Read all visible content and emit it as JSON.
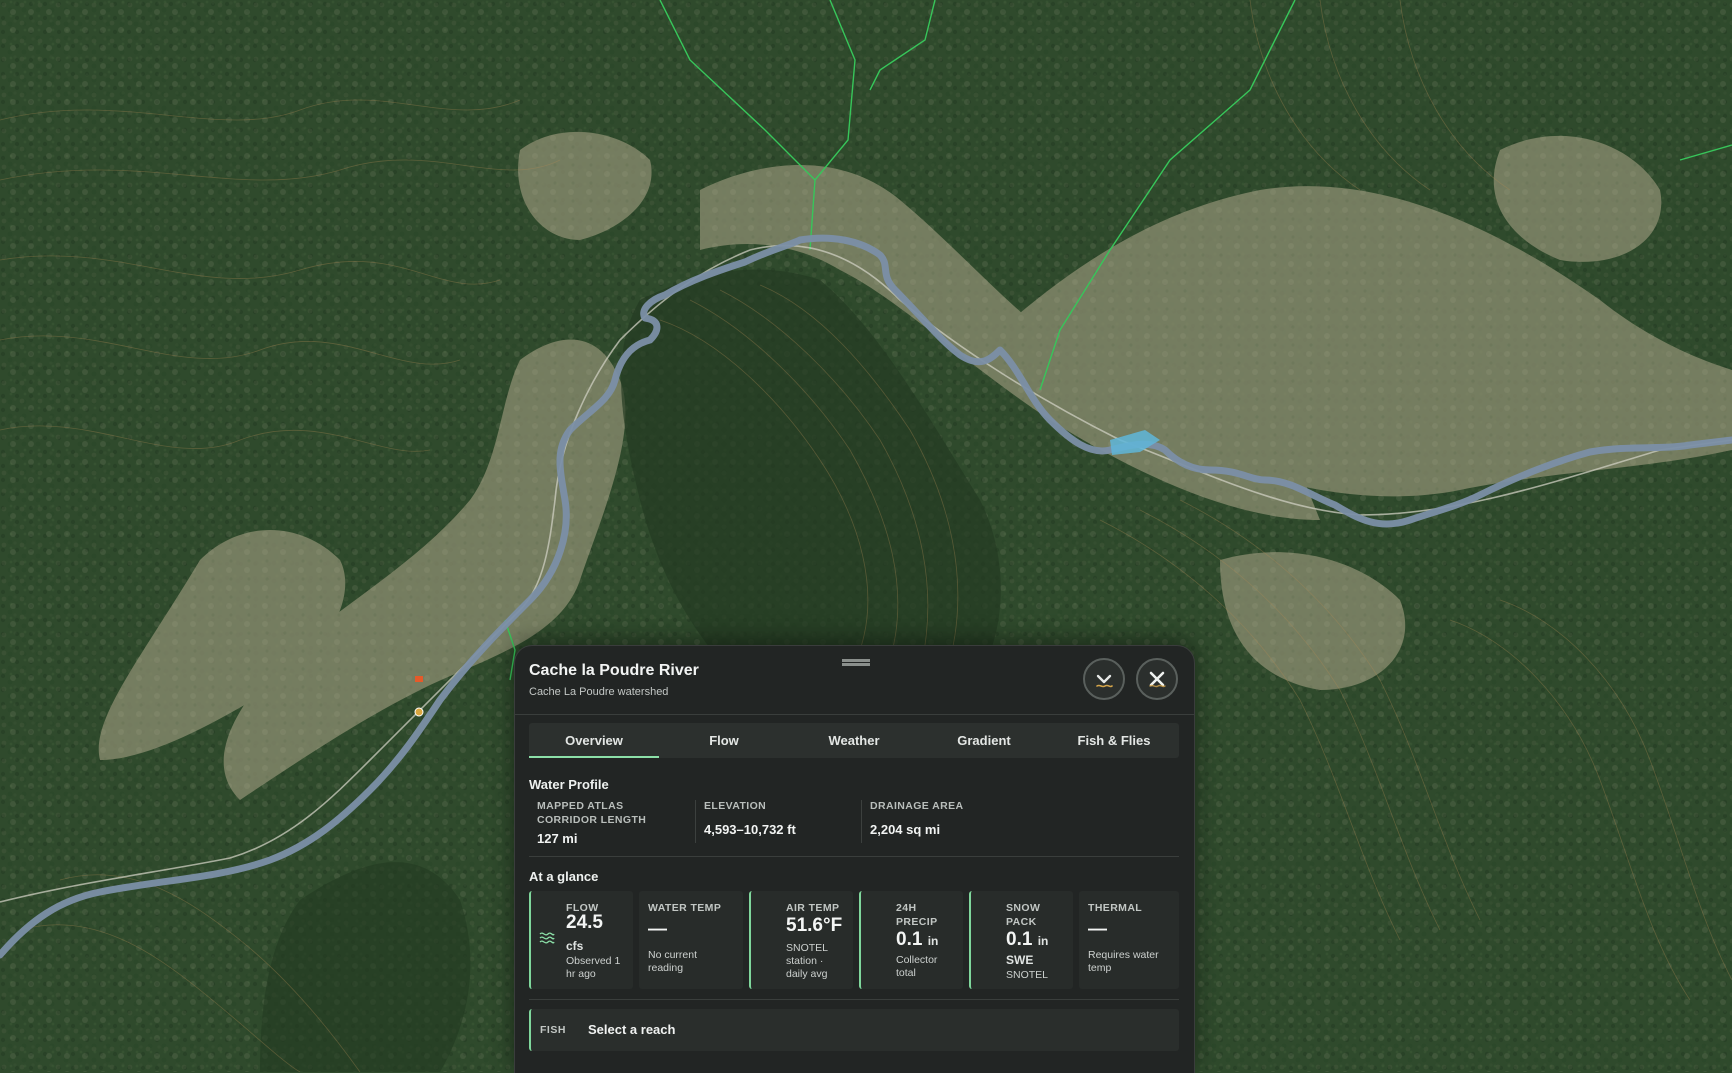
{
  "map": {
    "colors": {
      "forest": "#2f4a2c",
      "meadow": "#9a9a7c",
      "river": "#7b8fa6",
      "boundary": "#37c65a",
      "reservoir": "#5fb6d9"
    }
  },
  "panel": {
    "title": "Cache la Poudre River",
    "subtitle": "Cache La Poudre watershed",
    "tabs": [
      "Overview",
      "Flow",
      "Weather",
      "Gradient",
      "Fish & Flies"
    ],
    "active_tab": "Overview",
    "water_profile": {
      "title": "Water Profile",
      "items": [
        {
          "label": "MAPPED ATLAS CORRIDOR LENGTH",
          "value": "127 mi"
        },
        {
          "label": "ELEVATION",
          "value": "4,593–10,732 ft"
        },
        {
          "label": "DRAINAGE AREA",
          "value": "2,204 sq mi"
        }
      ]
    },
    "glance": {
      "title": "At a glance",
      "flow": {
        "label": "FLOW",
        "value": "24.5",
        "unit": "cfs",
        "note": "Observed 1 hr ago",
        "icon": "waves-icon"
      },
      "water_temp": {
        "label": "WATER TEMP",
        "value": "—",
        "note": "No current reading"
      },
      "air_temp": {
        "label": "AIR TEMP",
        "value": "51.6°F",
        "note": "SNOTEL station · daily avg"
      },
      "precip": {
        "label": "24H PRECIP",
        "value": "0.1",
        "unit": "in",
        "note": "Collector total"
      },
      "snow": {
        "label": "SNOW PACK",
        "value": "0.1",
        "unit": "in",
        "unit2": "SWE",
        "note": "SNOTEL"
      },
      "thermal": {
        "label": "THERMAL",
        "value": "—",
        "note": "Requires water temp"
      }
    },
    "fish": {
      "label": "FISH",
      "value": "Select a reach"
    },
    "accent_color": "#7fd79c"
  }
}
